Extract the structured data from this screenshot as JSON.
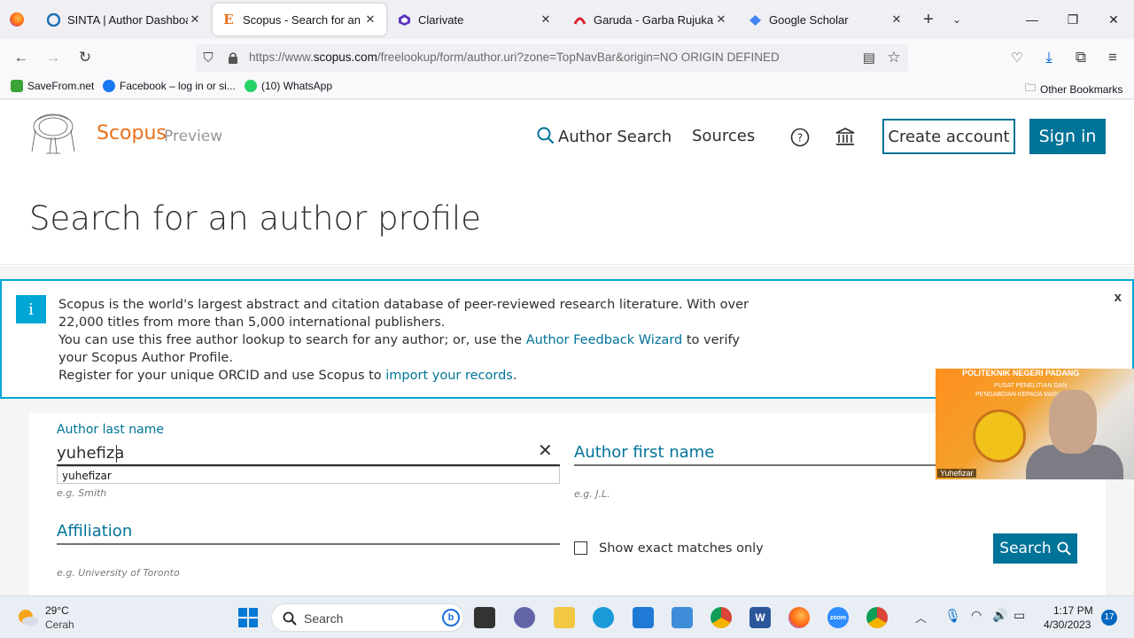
{
  "browser": {
    "tabs": [
      {
        "label": "SINTA | Author Dashboard",
        "icon": "sinta-icon"
      },
      {
        "label": "Scopus - Search for an au",
        "icon": "elsevier-icon",
        "active": true
      },
      {
        "label": "Clarivate",
        "icon": "clarivate-icon"
      },
      {
        "label": "Garuda - Garba Rujukan D",
        "icon": "garuda-icon"
      },
      {
        "label": "Google Scholar",
        "icon": "scholar-icon"
      }
    ],
    "url_prefix": "https://www.",
    "url_domain": "scopus.com",
    "url_rest": "/freelookup/form/author.uri?zone=TopNavBar&origin=NO ORIGIN DEFINED",
    "bookmarks": [
      {
        "label": "SaveFrom.net",
        "color": "#3aa437"
      },
      {
        "label": "Facebook – log in or si...",
        "color": "#1877f2"
      },
      {
        "label": "(10) WhatsApp",
        "color": "#25d366"
      }
    ],
    "other_bookmarks": "Other Bookmarks"
  },
  "scopus": {
    "brand": "Scopus",
    "brand_sub": "Preview",
    "nav_author_search": "Author Search",
    "nav_sources": "Sources",
    "create_account": "Create account",
    "sign_in": "Sign in",
    "page_title": "Search for an author profile",
    "accent": "#007398",
    "info": {
      "icon": "i",
      "close": "x",
      "line1": "Scopus is the world's largest abstract and citation database of peer-reviewed research literature. With over 22,000 titles from more than 5,000 international publishers.",
      "line2_a": "You can use this free author lookup to search for any author; or, use the ",
      "line2_link": "Author Feedback Wizard",
      "line2_b": " to verify your Scopus Author Profile.",
      "line3_a": "Register for your unique ORCID and use Scopus to ",
      "line3_link": "import your records",
      "line3_b": "."
    },
    "form": {
      "last_name_label": "Author last name",
      "last_name_value": "yuhefiza",
      "last_name_hint": "e.g. Smith",
      "autocomplete": "yuhefizar",
      "first_name_label": "Author first name",
      "first_name_hint": "e.g. J.L.",
      "affiliation_label": "Affiliation",
      "affiliation_hint": "e.g. University of Toronto",
      "exact_matches": "Show exact matches only",
      "search_button": "Search"
    }
  },
  "webcam": {
    "title": "POLITEKNIK NEGERI PADANG",
    "subtitle_1": "PUSAT PENELITIAN DAN",
    "subtitle_2": "PENGABDIAN KEPADA MASYARAKAT",
    "name": "Yuhefizar"
  },
  "taskbar": {
    "temp": "29°C",
    "weather": "Cerah",
    "search": "Search",
    "time": "1:17 PM",
    "date": "4/30/2023",
    "notifications": "17"
  }
}
